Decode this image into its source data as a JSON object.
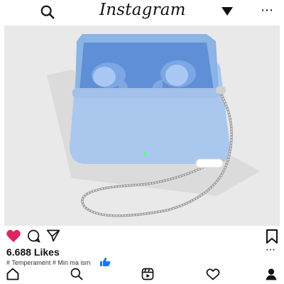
{
  "header": {
    "logo_text": "Instagram",
    "icons": [
      "search-icon",
      "dropdown-triangle-icon",
      "more-dots-icon"
    ]
  },
  "post": {
    "image_description": "Light blue wireless earbuds charging case with lanyard",
    "likes_text": "6.688 Likes",
    "tags_text": "# Temperament # Min ma ism",
    "liked": true,
    "accent_like_color": "#e0245e",
    "thumb_color": "#1877f2"
  },
  "bottom_nav": {
    "items": [
      "home-icon",
      "search-icon",
      "reels-icon",
      "activity-heart-icon",
      "profile-icon"
    ]
  }
}
